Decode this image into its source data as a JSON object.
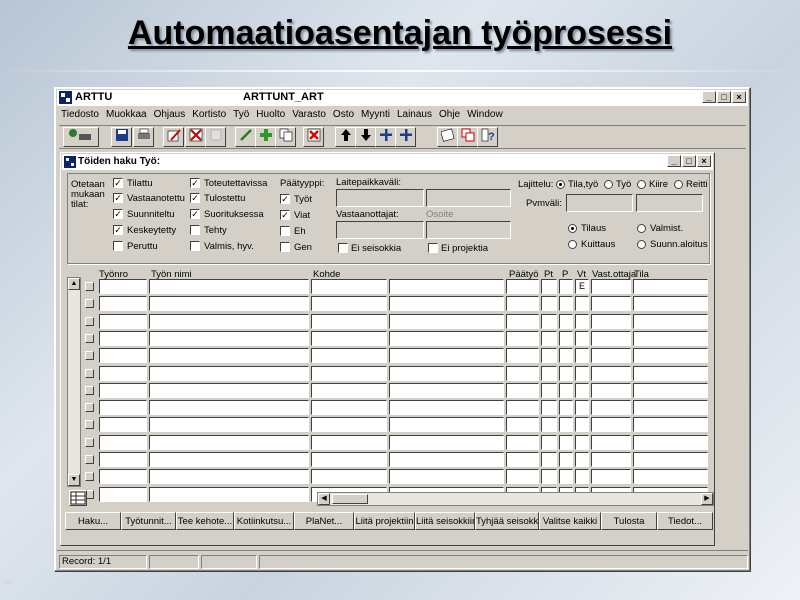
{
  "slide": {
    "title": "Automaatioasentajan työprosessi"
  },
  "app": {
    "name": "ARTTU",
    "document": "ARTTUNT_ART",
    "menu": [
      "Tiedosto",
      "Muokkaa",
      "Ohjaus",
      "Kortisto",
      "Työ",
      "Huolto",
      "Varasto",
      "Osto",
      "Myynti",
      "Lainaus",
      "Ohje",
      "Window"
    ],
    "window_buttons": {
      "minimize": "_",
      "restore": "□",
      "close": "×"
    }
  },
  "inner": {
    "title": "Töiden haku  Työ:",
    "filters": {
      "state_label": [
        "Otetaan",
        "mukaan",
        "tilat:"
      ],
      "states_col1": [
        {
          "label": "Tilattu",
          "checked": true
        },
        {
          "label": "Vastaanotettu",
          "checked": true
        },
        {
          "label": "Suunniteltu",
          "checked": true
        },
        {
          "label": "Keskeytetty",
          "checked": true
        },
        {
          "label": "Peruttu",
          "checked": false
        }
      ],
      "states_col2": [
        {
          "label": "Toteutettavissa",
          "checked": true
        },
        {
          "label": "Tulostettu",
          "checked": true
        },
        {
          "label": "Suorituksessa",
          "checked": true
        },
        {
          "label": "Tehty",
          "checked": false
        },
        {
          "label": "Valmis, hyv.",
          "checked": false
        }
      ],
      "main_type_label": "Päätyyppi:",
      "main_types": [
        {
          "label": "Työt",
          "checked": true
        },
        {
          "label": "Viat",
          "checked": true
        },
        {
          "label": "Eh",
          "checked": false
        },
        {
          "label": "Gen",
          "checked": false
        }
      ],
      "device_range_label": "Laitepaikkaväli:",
      "recipient_label": "Vastaanottajat:",
      "address_label": "Osoite",
      "no_outages_label": "Ei seisokkia",
      "no_projects_label": "Ei projektia",
      "sort_label": "Lajittelu:",
      "sort_options": [
        {
          "label": "Tila,työ",
          "selected": true
        },
        {
          "label": "Työ",
          "selected": false
        },
        {
          "label": "Kiire",
          "selected": false
        },
        {
          "label": "Reitti",
          "selected": false
        }
      ],
      "date_range_label": "Pvmväli:",
      "date_options": [
        {
          "label": "Tilaus",
          "selected": true
        },
        {
          "label": "Valmist.",
          "selected": false
        },
        {
          "label": "Kuittaus",
          "selected": false
        },
        {
          "label": "Suunn.aloitus",
          "selected": false
        }
      ]
    },
    "grid": {
      "columns": [
        "Työnro",
        "Työn nimi",
        "Kohde",
        "Päätyö",
        "Pt",
        "P",
        "Vt",
        "Vast.ottaja",
        "Tila"
      ],
      "first_row_vt": "E",
      "row_count": 13
    },
    "buttons": [
      "Haku...",
      "Työtunnit...",
      "Tee kehote...",
      "Kotiinkutsu...",
      "PlaNet...",
      "Liitä projektiin",
      "Liitä seisokkiin",
      "Tyhjää seisokki",
      "Valitse kaikki",
      "Tulosta",
      "Tiedot..."
    ]
  },
  "status": {
    "record": "Record: 1/1"
  }
}
